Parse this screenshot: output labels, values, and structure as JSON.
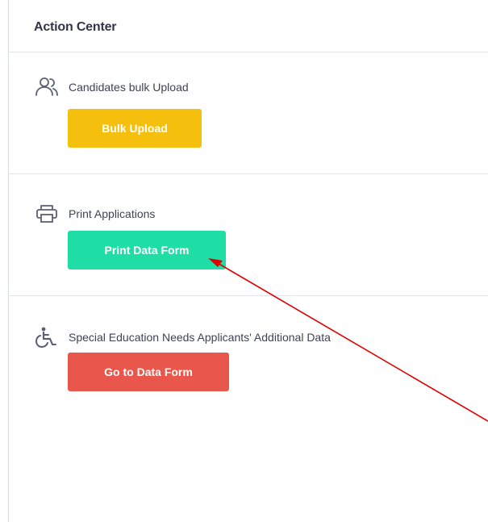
{
  "header": {
    "title": "Action Center"
  },
  "sections": [
    {
      "label": "Candidates bulk Upload",
      "icon": "users-icon",
      "button_label": "Bulk Upload",
      "button_color": "#f4bf0d"
    },
    {
      "label": "Print Applications",
      "icon": "printer-icon",
      "button_label": "Print Data Form",
      "button_color": "#1fdea5"
    },
    {
      "label": "Special Education Needs Applicants' Additional Data",
      "icon": "wheelchair-icon",
      "button_label": "Go to Data Form",
      "button_color": "#e9574c"
    }
  ],
  "annotation": {
    "arrow_color": "#e00000"
  }
}
